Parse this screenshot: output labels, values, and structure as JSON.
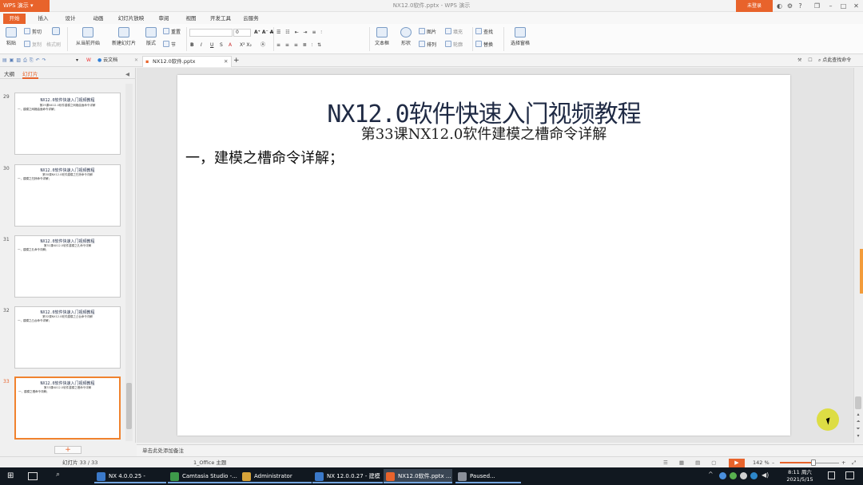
{
  "app": {
    "menu_label": "WPS 演示",
    "window_title": "NX12.0软件.pptx - WPS 演示",
    "login_label": "未登录",
    "accent": "#e8632b"
  },
  "ribbon_tabs": [
    "开始",
    "插入",
    "设计",
    "动画",
    "幻灯片放映",
    "审阅",
    "视图",
    "开发工具",
    "云服务"
  ],
  "ribbon": {
    "paste": "粘贴",
    "cut": "剪切",
    "copy": "复制",
    "format_painter": "格式刷",
    "from_current": "从当前开始",
    "new_slide": "新建幻灯片",
    "layout": "版式",
    "reset": "重置",
    "section": "节",
    "font_size": "0",
    "textbox": "文本框",
    "shape": "形状",
    "picture": "图片",
    "fill": "填充",
    "arrange": "排列",
    "outline": "轮廓",
    "find": "查找",
    "replace": "替换",
    "select_pane": "选择窗格"
  },
  "quickbar": {
    "cloud_docs": "云文档",
    "doc_tab": "NX12.0软件.pptx",
    "search_cmd": "点此查找命令"
  },
  "left_panel": {
    "tab_outline": "大纲",
    "tab_slides": "幻灯片",
    "thumbnails": [
      {
        "num": "29",
        "title": "NX12.0软件快速入门视频教程",
        "sub": "第29课NX12.0软件建模之网格曲面命令详解",
        "body": "一，建模之网格曲面命令详解；"
      },
      {
        "num": "30",
        "title": "NX12.0软件快速入门视频教程",
        "sub": "第30课NX12.0软件建模之扫掠命令详解",
        "body": "一，建模之扫掠命令详解；"
      },
      {
        "num": "31",
        "title": "NX12.0软件快速入门视频教程",
        "sub": "第31课NX12.0软件建模之孔命令详解",
        "body": "一，建模之孔命令详解；"
      },
      {
        "num": "32",
        "title": "NX12.0软件快速入门视频教程",
        "sub": "第32课NX12.0软件建模之凸台命令详解",
        "body": "一，建模之凸台命令详解；"
      },
      {
        "num": "33",
        "title": "NX12.0软件快速入门视频教程",
        "sub": "第33课NX12.0软件建模之槽命令详解",
        "body": "一，建模之槽命令详解；"
      }
    ],
    "add_slide": "+"
  },
  "slide": {
    "title": "NX12.0软件快速入门视频教程",
    "subtitle": "第33课NX12.0软件建模之槽命令详解",
    "body": "一，建模之槽命令详解；"
  },
  "notes_placeholder": "单击此处添加备注",
  "status": {
    "slide_counter": "幻灯片 33 / 33",
    "theme": "1_Office 主题",
    "zoom": "142 %",
    "zoom_fraction": 0.57
  },
  "taskbar": {
    "items": [
      {
        "label": "NX 4.0.0.25 -",
        "color": "#3b79c9"
      },
      {
        "label": "Camtasia Studio -...",
        "color": "#3e9a4a"
      },
      {
        "label": "Administrator",
        "color": "#d7a43a"
      },
      {
        "label": "NX 12.0.0.27 - 建模",
        "color": "#3b79c9"
      },
      {
        "label": "NX12.0软件.pptx ...",
        "color": "#e8632b"
      },
      {
        "label": "Paused...",
        "color": "#8a8f99"
      }
    ],
    "time": "8:11 周六",
    "date": "2021/5/15"
  }
}
